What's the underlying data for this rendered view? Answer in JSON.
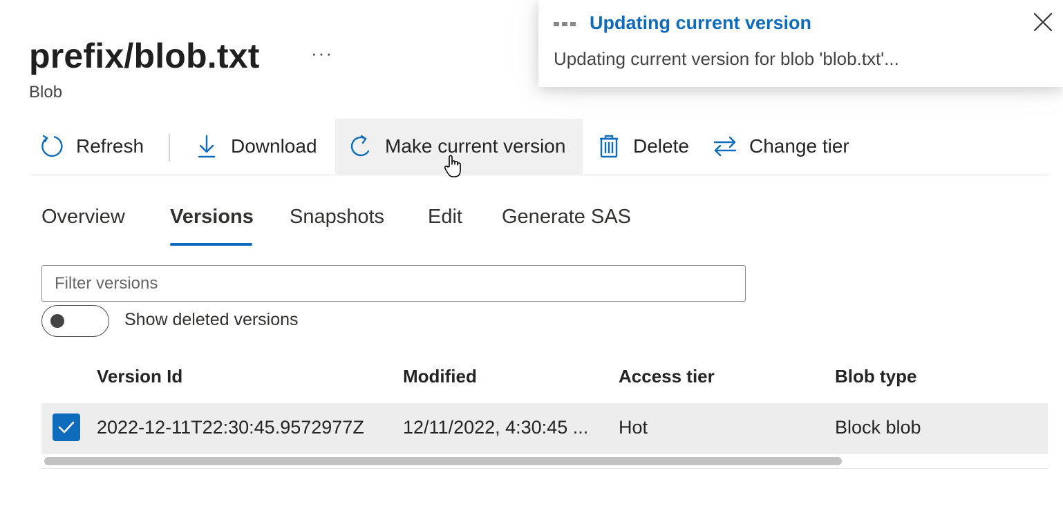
{
  "header": {
    "title": "prefix/blob.txt",
    "more_label": "···",
    "subtitle": "Blob"
  },
  "toolbar": {
    "refresh_label": "Refresh",
    "download_label": "Download",
    "make_current_label": "Make current version",
    "delete_label": "Delete",
    "change_tier_label": "Change tier"
  },
  "tabs": [
    {
      "label": "Overview"
    },
    {
      "label": "Versions",
      "active": true
    },
    {
      "label": "Snapshots"
    },
    {
      "label": "Edit"
    },
    {
      "label": "Generate SAS"
    }
  ],
  "filter": {
    "placeholder": "Filter versions",
    "value": ""
  },
  "show_deleted": {
    "label": "Show deleted versions",
    "on": false
  },
  "table": {
    "columns": [
      "Version Id",
      "Modified",
      "Access tier",
      "Blob type"
    ],
    "rows": [
      {
        "selected": true,
        "version_id": "2022-12-11T22:30:45.9572977Z",
        "modified": "12/11/2022, 4:30:45 ...",
        "access_tier": "Hot",
        "blob_type": "Block blob"
      }
    ]
  },
  "notification": {
    "title": "Updating current version",
    "message": "Updating current version for blob 'blob.txt'..."
  },
  "colors": {
    "accent": "#0f6cbd",
    "row_selected_bg": "#ededed"
  },
  "icons": {
    "refresh": "refresh-icon",
    "download": "download-icon",
    "make_current": "make-current-icon",
    "delete": "trash-icon",
    "change_tier": "swap-arrows-icon",
    "close": "close-icon"
  }
}
